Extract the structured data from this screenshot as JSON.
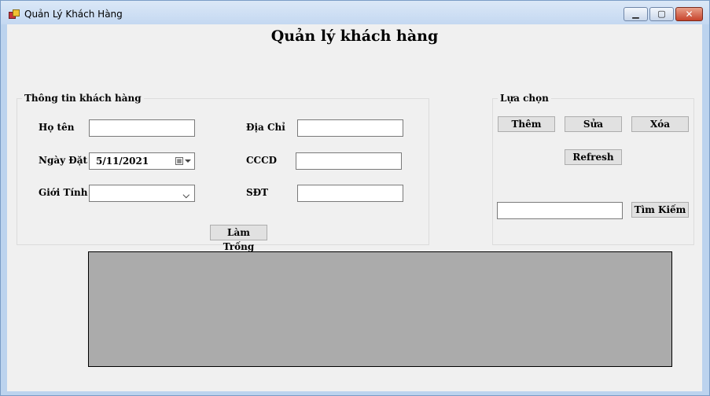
{
  "window": {
    "title": "Quản Lý Khách Hàng",
    "min_glyph": "▁",
    "max_glyph": "▢",
    "close_glyph": "✕"
  },
  "heading": "Quản lý khách hàng",
  "customer_info": {
    "title": "Thông tin khách hàng",
    "ho_ten_label": "Họ tên",
    "ho_ten_value": "",
    "ngay_dat_label": "Ngày Đặt",
    "ngay_dat_value": "5/11/2021",
    "gioi_tinh_label": "Giới Tính",
    "gioi_tinh_value": "",
    "dia_chi_label": "Địa Chỉ",
    "dia_chi_value": "",
    "cccd_label": "CCCD",
    "cccd_value": "",
    "sdt_label": "SĐT",
    "sdt_value": "",
    "clear_button": "Làm Trống"
  },
  "options": {
    "title": "Lựa chọn",
    "add_button": "Thêm",
    "edit_button": "Sửa",
    "delete_button": "Xóa",
    "refresh_button": "Refresh",
    "search_value": "",
    "search_button": "Tìm Kiếm"
  }
}
